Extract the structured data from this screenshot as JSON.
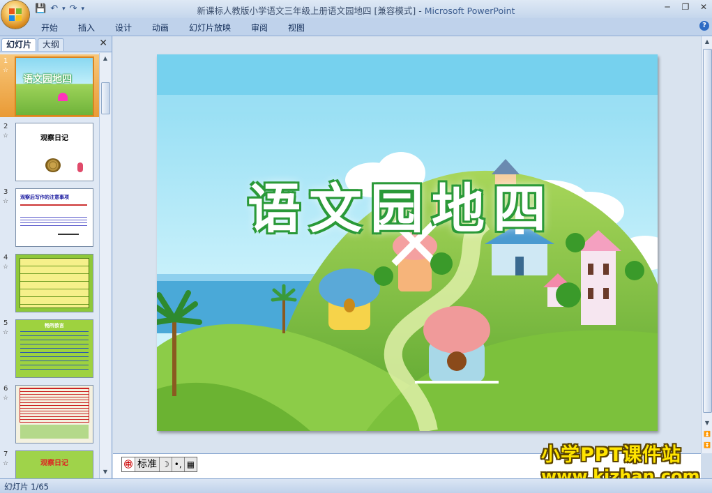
{
  "window": {
    "title": "新课标人教版小学语文三年级上册语文园地四 [兼容模式]",
    "app_name": "Microsoft PowerPoint",
    "separator": " - "
  },
  "ribbon": {
    "tabs": [
      "开始",
      "插入",
      "设计",
      "动画",
      "幻灯片放映",
      "审阅",
      "视图"
    ]
  },
  "left_panel": {
    "tabs": [
      "幻灯片",
      "大纲"
    ],
    "close_label": "✕"
  },
  "thumbnails": [
    {
      "num": "1",
      "sub": "☆",
      "title": "语文园地四"
    },
    {
      "num": "2",
      "sub": "☆",
      "title": "观察日记"
    },
    {
      "num": "3",
      "sub": "☆",
      "title": "观察后写作的注意事项"
    },
    {
      "num": "4",
      "sub": "☆",
      "title": ""
    },
    {
      "num": "5",
      "sub": "☆",
      "title": "畅所欲言"
    },
    {
      "num": "6",
      "sub": "☆",
      "title": ""
    },
    {
      "num": "7",
      "sub": "☆",
      "title": "观察日记"
    }
  ],
  "slide": {
    "title": "语文园地四"
  },
  "ime": {
    "mode": "标准",
    "moon": "☽",
    "punct": "•,",
    "keyboard": "▦"
  },
  "status": {
    "slide_counter": "幻灯片 1/65"
  },
  "watermark": {
    "line1": "小学PPT课件站",
    "line2": "www.kjzhan.com"
  },
  "colors": {
    "sky": "#8fdcf3",
    "hill": "#86c94a",
    "title_fill": "#ffffff",
    "title_stroke": "#3aa43a"
  }
}
